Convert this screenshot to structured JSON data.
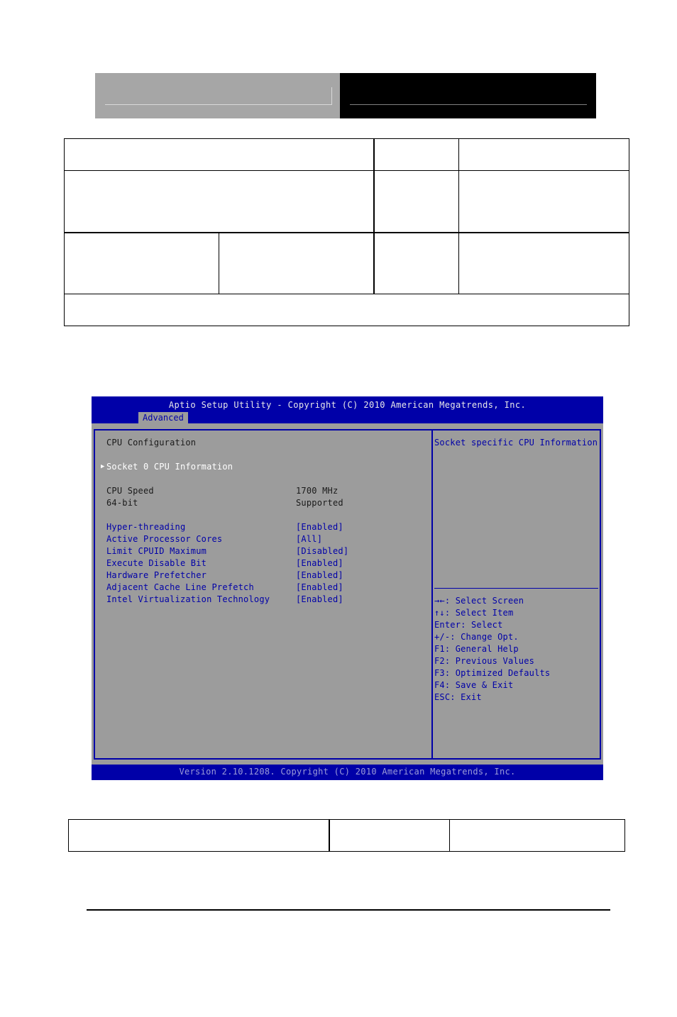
{
  "bios": {
    "title": "Aptio Setup Utility - Copyright (C) 2010 American Megatrends, Inc.",
    "active_tab": "Advanced",
    "section_title": "CPU Configuration",
    "submenu": {
      "label": "Socket 0 CPU Information",
      "selected": true,
      "icon": "triangle-right-icon"
    },
    "info_rows": [
      {
        "label": "CPU Speed",
        "value": "1700 MHz"
      },
      {
        "label": "64-bit",
        "value": "Supported"
      }
    ],
    "options": [
      {
        "label": "Hyper-threading",
        "value": "[Enabled]"
      },
      {
        "label": "Active Processor Cores",
        "value": "[All]"
      },
      {
        "label": "Limit CPUID Maximum",
        "value": "[Disabled]"
      },
      {
        "label": "Execute Disable Bit",
        "value": "[Enabled]"
      },
      {
        "label": "Hardware Prefetcher",
        "value": "[Enabled]"
      },
      {
        "label": "Adjacent Cache Line Prefetch",
        "value": "[Enabled]"
      },
      {
        "label": "Intel Virtualization Technology",
        "value": "[Enabled]"
      }
    ],
    "help_text": "Socket specific CPU Information",
    "key_help": [
      "→←: Select Screen",
      "↑↓: Select Item",
      "Enter: Select",
      "+/-: Change Opt.",
      "F1: General Help",
      "F2: Previous Values",
      "F3: Optimized Defaults",
      "F4: Save & Exit",
      "ESC: Exit"
    ],
    "version": "Version 2.10.1208. Copyright (C) 2010 American Megatrends, Inc.",
    "colors": {
      "frame_blue": "#0000a8",
      "panel_gray": "#9c9c9c",
      "selected_text": "#ffffff",
      "static_text": "#1a1a1a"
    }
  }
}
